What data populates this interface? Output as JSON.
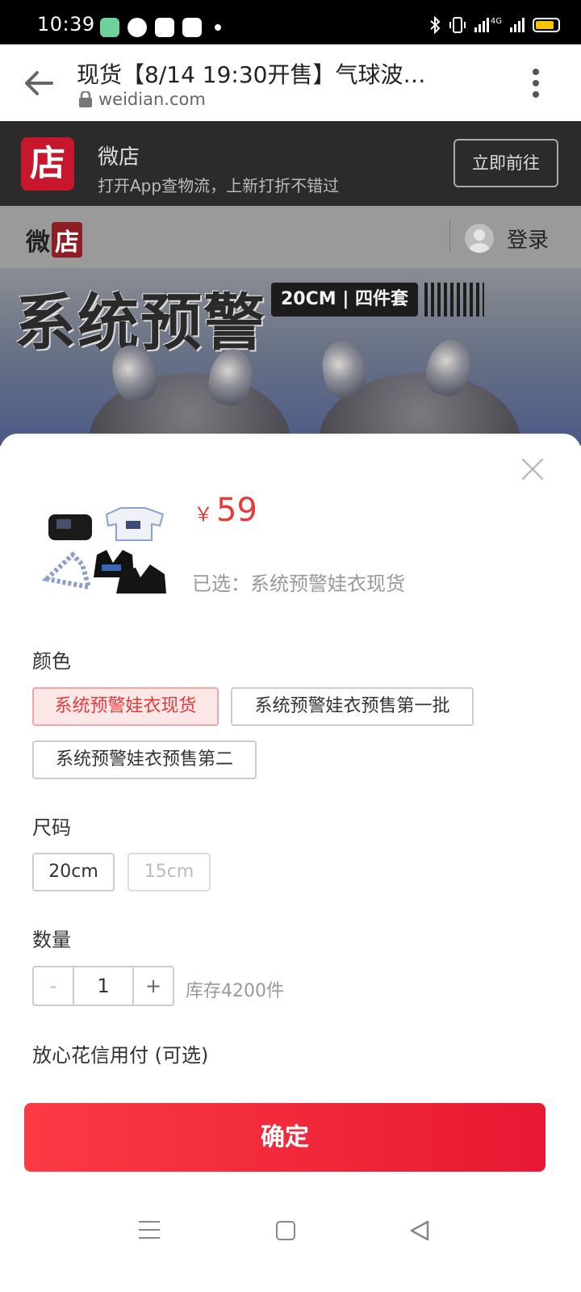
{
  "status_bar": {
    "time": "10:39",
    "network": "4G",
    "icons": [
      "app-icon",
      "messenger-icon",
      "shopping-bag-icon",
      "weidian-icon",
      "dot-icon",
      "bluetooth-icon",
      "vibrate-icon",
      "signal-icon",
      "battery-icon"
    ]
  },
  "browser": {
    "title": "现货【8/14 19:30开售】气球波…",
    "domain": "weidian.com"
  },
  "app_banner": {
    "logo_char": "店",
    "name": "微店",
    "subtitle": "打开App查物流，上新打折不错过",
    "open_button": "立即前往"
  },
  "site_header": {
    "logo_part1": "微",
    "logo_part2": "店",
    "login": "登录"
  },
  "hero": {
    "title": "系统预警",
    "badge": "20CM | 四件套"
  },
  "sheet": {
    "price_currency": "￥",
    "price": "59",
    "selected": "已选：系统预警娃衣现货",
    "color_label": "颜色",
    "color_options": [
      "系统预警娃衣现货",
      "系统预警娃衣预售第一批",
      "系统预警娃衣预售第二"
    ],
    "size_label": "尺码",
    "size_options": [
      "20cm",
      "15cm"
    ],
    "qty_label": "数量",
    "qty_minus": "-",
    "qty_value": "1",
    "qty_plus": "+",
    "stock": "库存4200件",
    "credit_label": "放心花信用付 (可选)",
    "confirm": "确定"
  },
  "colors": {
    "accent_red": "#e83a3a",
    "button_gradient_start": "#fb3a44",
    "button_gradient_end": "#e81832",
    "banner_dark": "#2b2b2b"
  }
}
